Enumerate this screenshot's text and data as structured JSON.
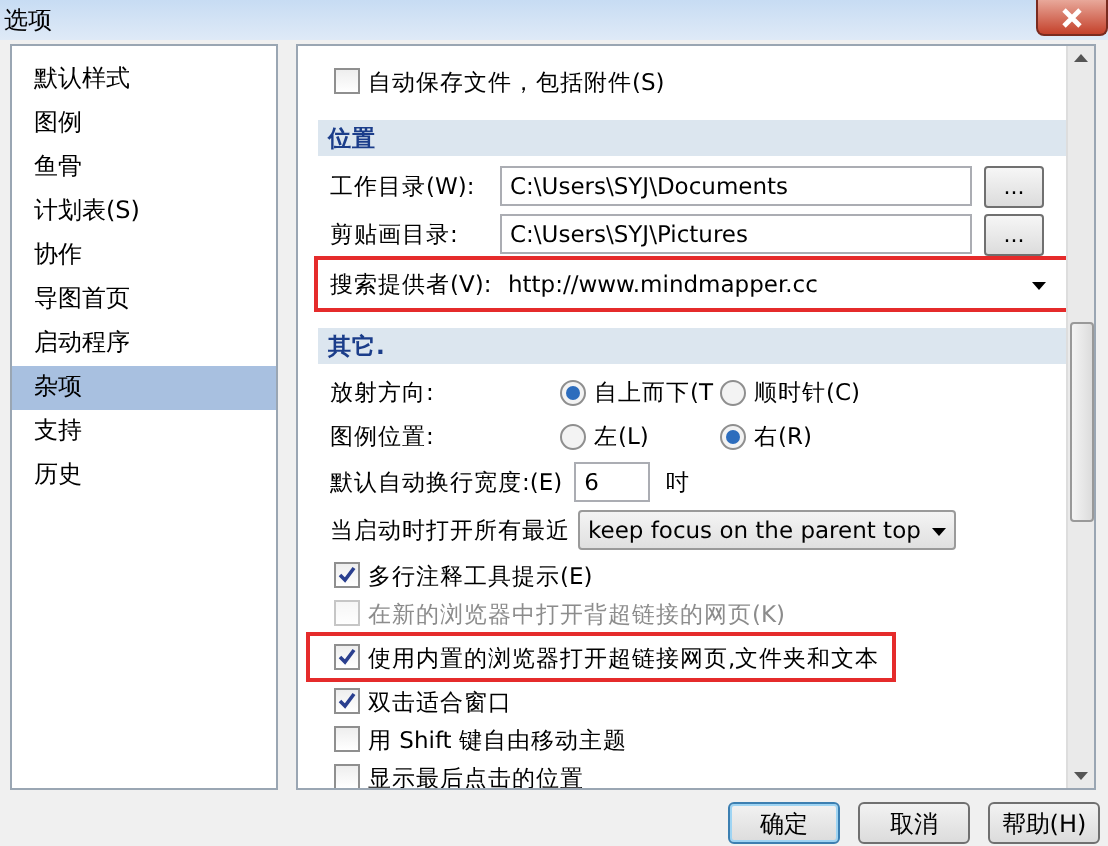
{
  "window": {
    "title": "选项"
  },
  "sidebar": {
    "items": [
      {
        "label": "默认样式",
        "selected": false
      },
      {
        "label": "图例",
        "selected": false
      },
      {
        "label": "鱼骨",
        "selected": false
      },
      {
        "label": "计划表(S)",
        "selected": false
      },
      {
        "label": "协作",
        "selected": false
      },
      {
        "label": "导图首页",
        "selected": false
      },
      {
        "label": "启动程序",
        "selected": false
      },
      {
        "label": "杂项",
        "selected": true
      },
      {
        "label": "支持",
        "selected": false
      },
      {
        "label": "历史",
        "selected": false
      }
    ]
  },
  "options": [
    {
      "kind": "checkbox",
      "label": "自动保存文件，包括附件(S)",
      "checked": false,
      "disabled": false,
      "highlighted": false
    },
    {
      "kind": "section",
      "label": "位置"
    },
    {
      "kind": "path",
      "label": "工作目录(W):",
      "value": "C:\\Users\\SYJ\\Documents",
      "button": "..."
    },
    {
      "kind": "path",
      "label": "剪贴画目录:",
      "value": "C:\\Users\\SYJ\\Pictures",
      "button": "..."
    },
    {
      "kind": "combo",
      "label": "搜索提供者(V):",
      "value": "http://www.mindmapper.cc",
      "highlighted": true
    },
    {
      "kind": "section",
      "label": "其它."
    },
    {
      "kind": "radio",
      "label": "放射方向:",
      "options": [
        {
          "label": "自上而下(T",
          "selected": true
        },
        {
          "label": "顺时针(C)",
          "selected": false
        }
      ]
    },
    {
      "kind": "radio",
      "label": "图例位置:",
      "options": [
        {
          "label": "左(L)",
          "selected": false
        },
        {
          "label": "右(R)",
          "selected": true
        }
      ]
    },
    {
      "kind": "number",
      "label": "默认自动换行宽度:(E)",
      "value": "6",
      "unit": "吋"
    },
    {
      "kind": "select",
      "label": "当启动时打开所有最近",
      "value": "keep focus on the parent top"
    },
    {
      "kind": "checkbox",
      "label": "多行注释工具提示(E)",
      "checked": true,
      "disabled": false,
      "highlighted": false
    },
    {
      "kind": "checkbox",
      "label": "在新的浏览器中打开背超链接的网页(K)",
      "checked": false,
      "disabled": true,
      "highlighted": false
    },
    {
      "kind": "checkbox",
      "label": "使用内置的浏览器打开超链接网页,文件夹和文本",
      "checked": true,
      "disabled": false,
      "highlighted": true
    },
    {
      "kind": "checkbox",
      "label": "双击适合窗口",
      "checked": true,
      "disabled": false,
      "highlighted": false
    },
    {
      "kind": "checkbox",
      "label": "用 Shift 键自由移动主题",
      "checked": false,
      "disabled": false,
      "highlighted": false
    },
    {
      "kind": "checkbox",
      "label": "显示最后点击的位置",
      "checked": false,
      "disabled": false,
      "highlighted": false
    }
  ],
  "buttons": [
    {
      "label": "确定",
      "default": true
    },
    {
      "label": "取消",
      "default": false
    },
    {
      "label": "帮助(H)",
      "default": false
    }
  ]
}
